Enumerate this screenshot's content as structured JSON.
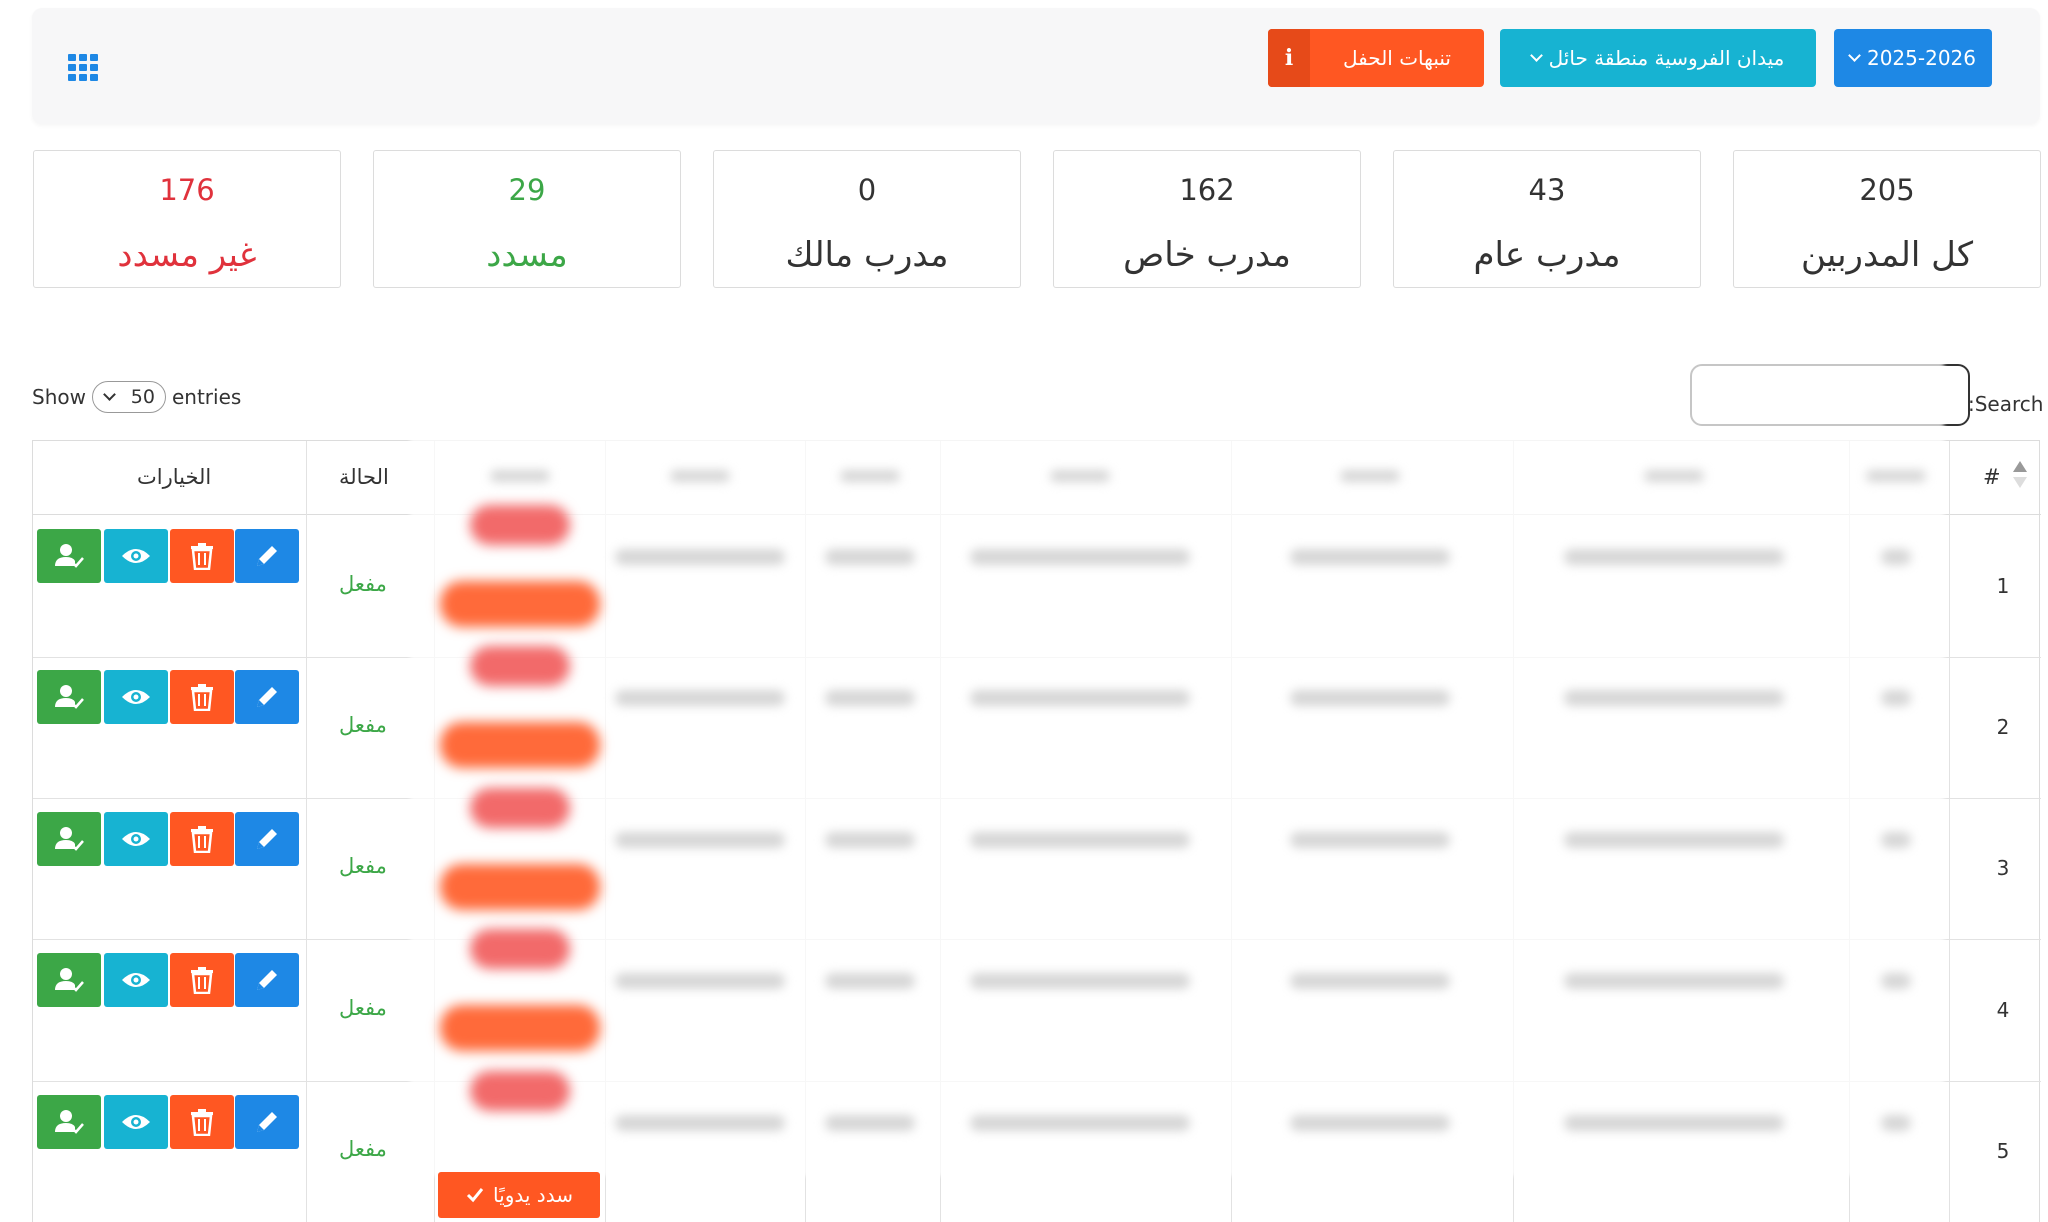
{
  "topbar": {
    "year_label": "2025-2026",
    "arena_label": "ميدان الفروسية منطقة حائل",
    "alerts_label": "تنبهات الحفل",
    "alerts_icon": "i",
    "colors": {
      "year": "#1e88e5",
      "arena": "#17b3d2",
      "alerts": "#ff5722"
    }
  },
  "stats": [
    {
      "value": "205",
      "label": "كل المدربين"
    },
    {
      "value": "43",
      "label": "مدرب عام"
    },
    {
      "value": "162",
      "label": "مدرب خاص"
    },
    {
      "value": "0",
      "label": "مدرب مالك"
    },
    {
      "value": "29",
      "label": "مسدد"
    },
    {
      "value": "176",
      "label": "غير مسدد"
    }
  ],
  "table_controls": {
    "show_label": "Show",
    "entries_value": "50",
    "entries_label": "entries",
    "search_label": ":Search"
  },
  "table": {
    "headers": {
      "number": "#",
      "status": "الحالة",
      "options": "الخيارات"
    },
    "rows": [
      {
        "num": "1",
        "status": "مفعل"
      },
      {
        "num": "2",
        "status": "مفعل"
      },
      {
        "num": "3",
        "status": "مفعل"
      },
      {
        "num": "4",
        "status": "مفعل"
      },
      {
        "num": "5",
        "status": "مفعل"
      }
    ],
    "manual_pay_label": "سدد يدويًا"
  },
  "icons": [
    "apps-grid-icon",
    "chevron-down-icon",
    "info-icon",
    "sort-icon",
    "user-check-icon",
    "eye-icon",
    "trash-icon",
    "pencil-icon",
    "check-icon"
  ]
}
